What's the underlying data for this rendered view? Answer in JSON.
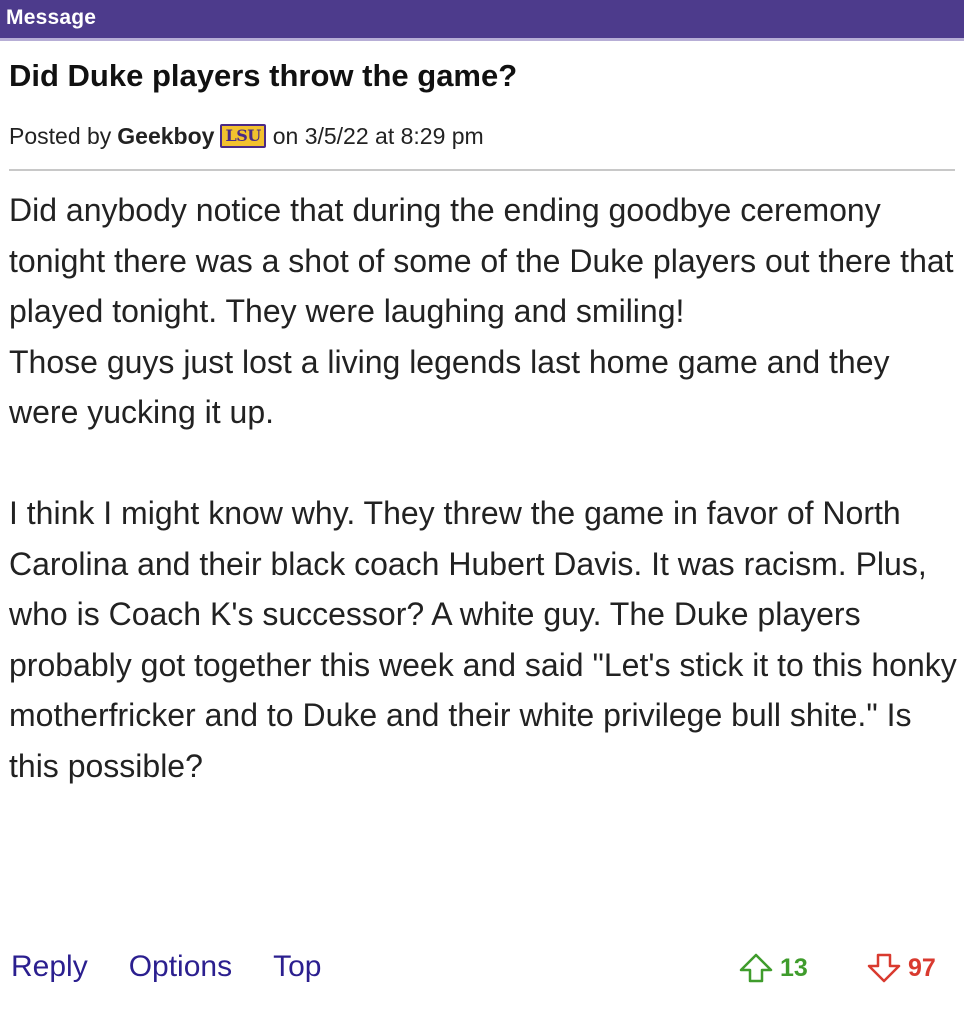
{
  "header": {
    "title": "Message",
    "bar_color": "#4d3b8c"
  },
  "post": {
    "title": "Did Duke players throw the game?",
    "posted_by_prefix": "Posted by",
    "author": "Geekboy",
    "team_badge": "LSU",
    "date_text": "on 3/5/22 at 8:29 pm",
    "body_paragraph_1_line_1": "Did anybody notice that during the ending goodbye ceremony tonight there was a shot of some of the Duke players out there that played tonight. They were laughing and smiling!",
    "body_paragraph_1_line_2": "Those guys just lost a living legends last home game and they were yucking it up.",
    "body_paragraph_2": "I think I might know why. They threw the game in favor of North Carolina and their black coach Hubert Davis. It was racism. Plus, who is Coach K's successor? A white guy. The Duke players probably got together this week and said \"Let's stick it to this honky motherfricker and to Duke and their white privilege bull shite.\" Is this possible?"
  },
  "actions": {
    "reply": "Reply",
    "options": "Options",
    "top": "Top"
  },
  "votes": {
    "up_count": "13",
    "down_count": "97",
    "up_icon": "thumb-arrow-up-icon",
    "down_icon": "thumb-arrow-down-icon",
    "up_color": "#3f9c2c",
    "down_color": "#d93a2f"
  }
}
